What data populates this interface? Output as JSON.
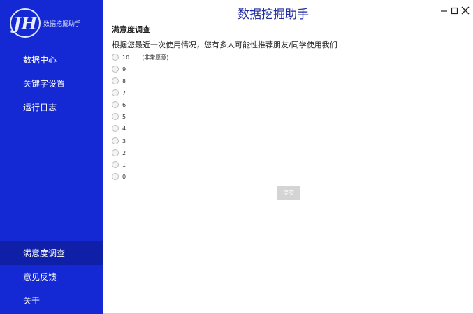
{
  "app": {
    "brand_name": "数据挖掘助手",
    "title": "数据挖掘助手",
    "logo_text": "JH"
  },
  "sidebar": {
    "top_items": [
      {
        "label": "数据中心"
      },
      {
        "label": "关键字设置"
      },
      {
        "label": "运行日志"
      }
    ],
    "bottom_items": [
      {
        "label": "满意度调查",
        "active": true
      },
      {
        "label": "意见反馈"
      },
      {
        "label": "关于"
      }
    ]
  },
  "survey": {
    "title": "满意度调查",
    "question": "根据您最近一次使用情况，您有多人可能性推荐朋友/同学使用我们",
    "options": [
      {
        "value": "10",
        "hint": "(非常愿意)"
      },
      {
        "value": "9"
      },
      {
        "value": "8"
      },
      {
        "value": "7"
      },
      {
        "value": "6"
      },
      {
        "value": "5"
      },
      {
        "value": "4"
      },
      {
        "value": "3"
      },
      {
        "value": "2"
      },
      {
        "value": "1"
      },
      {
        "value": "0"
      }
    ],
    "submit_label": "提交"
  },
  "window_controls": [
    "minimize-icon",
    "maximize-icon",
    "close-icon"
  ],
  "colors": {
    "sidebar_bg": "#1428d4",
    "sidebar_active": "#0f1fa8",
    "title_color": "#1f2aa0",
    "button_disabled": "#d4d4d4"
  }
}
